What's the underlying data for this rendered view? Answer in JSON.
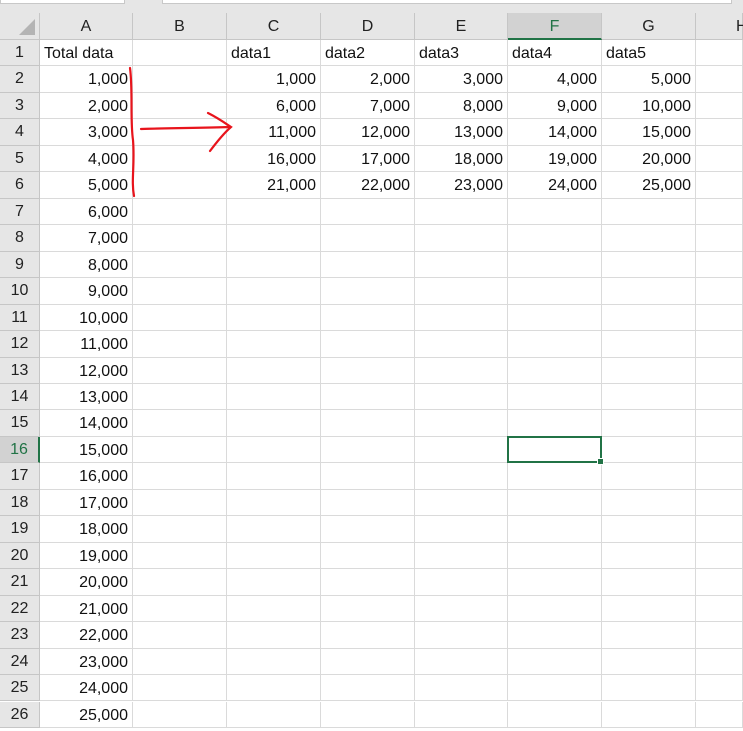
{
  "sheet": {
    "columns": [
      "A",
      "B",
      "C",
      "D",
      "E",
      "F",
      "G",
      "H"
    ],
    "row_count": 26,
    "selected_cell": {
      "column": "F",
      "row": 16
    },
    "accent_color": "#217346",
    "annotation_color": "#e8141c",
    "cells": {
      "A1": "Total data",
      "A2": "1,000",
      "A3": "2,000",
      "A4": "3,000",
      "A5": "4,000",
      "A6": "5,000",
      "A7": "6,000",
      "A8": "7,000",
      "A9": "8,000",
      "A10": "9,000",
      "A11": "10,000",
      "A12": "11,000",
      "A13": "12,000",
      "A14": "13,000",
      "A15": "14,000",
      "A16": "15,000",
      "A17": "16,000",
      "A18": "17,000",
      "A19": "18,000",
      "A20": "19,000",
      "A21": "20,000",
      "A22": "21,000",
      "A23": "22,000",
      "A24": "23,000",
      "A25": "24,000",
      "A26": "25,000",
      "C1": "data1",
      "D1": "data2",
      "E1": "data3",
      "F1": "data4",
      "G1": "data5",
      "C2": "1,000",
      "D2": "2,000",
      "E2": "3,000",
      "F2": "4,000",
      "G2": "5,000",
      "C3": "6,000",
      "D3": "7,000",
      "E3": "8,000",
      "F3": "9,000",
      "G3": "10,000",
      "C4": "11,000",
      "D4": "12,000",
      "E4": "13,000",
      "F4": "14,000",
      "G4": "15,000",
      "C5": "16,000",
      "D5": "17,000",
      "E5": "18,000",
      "F5": "19,000",
      "G5": "20,000",
      "C6": "21,000",
      "D6": "22,000",
      "E6": "23,000",
      "F6": "24,000",
      "G6": "25,000"
    }
  }
}
